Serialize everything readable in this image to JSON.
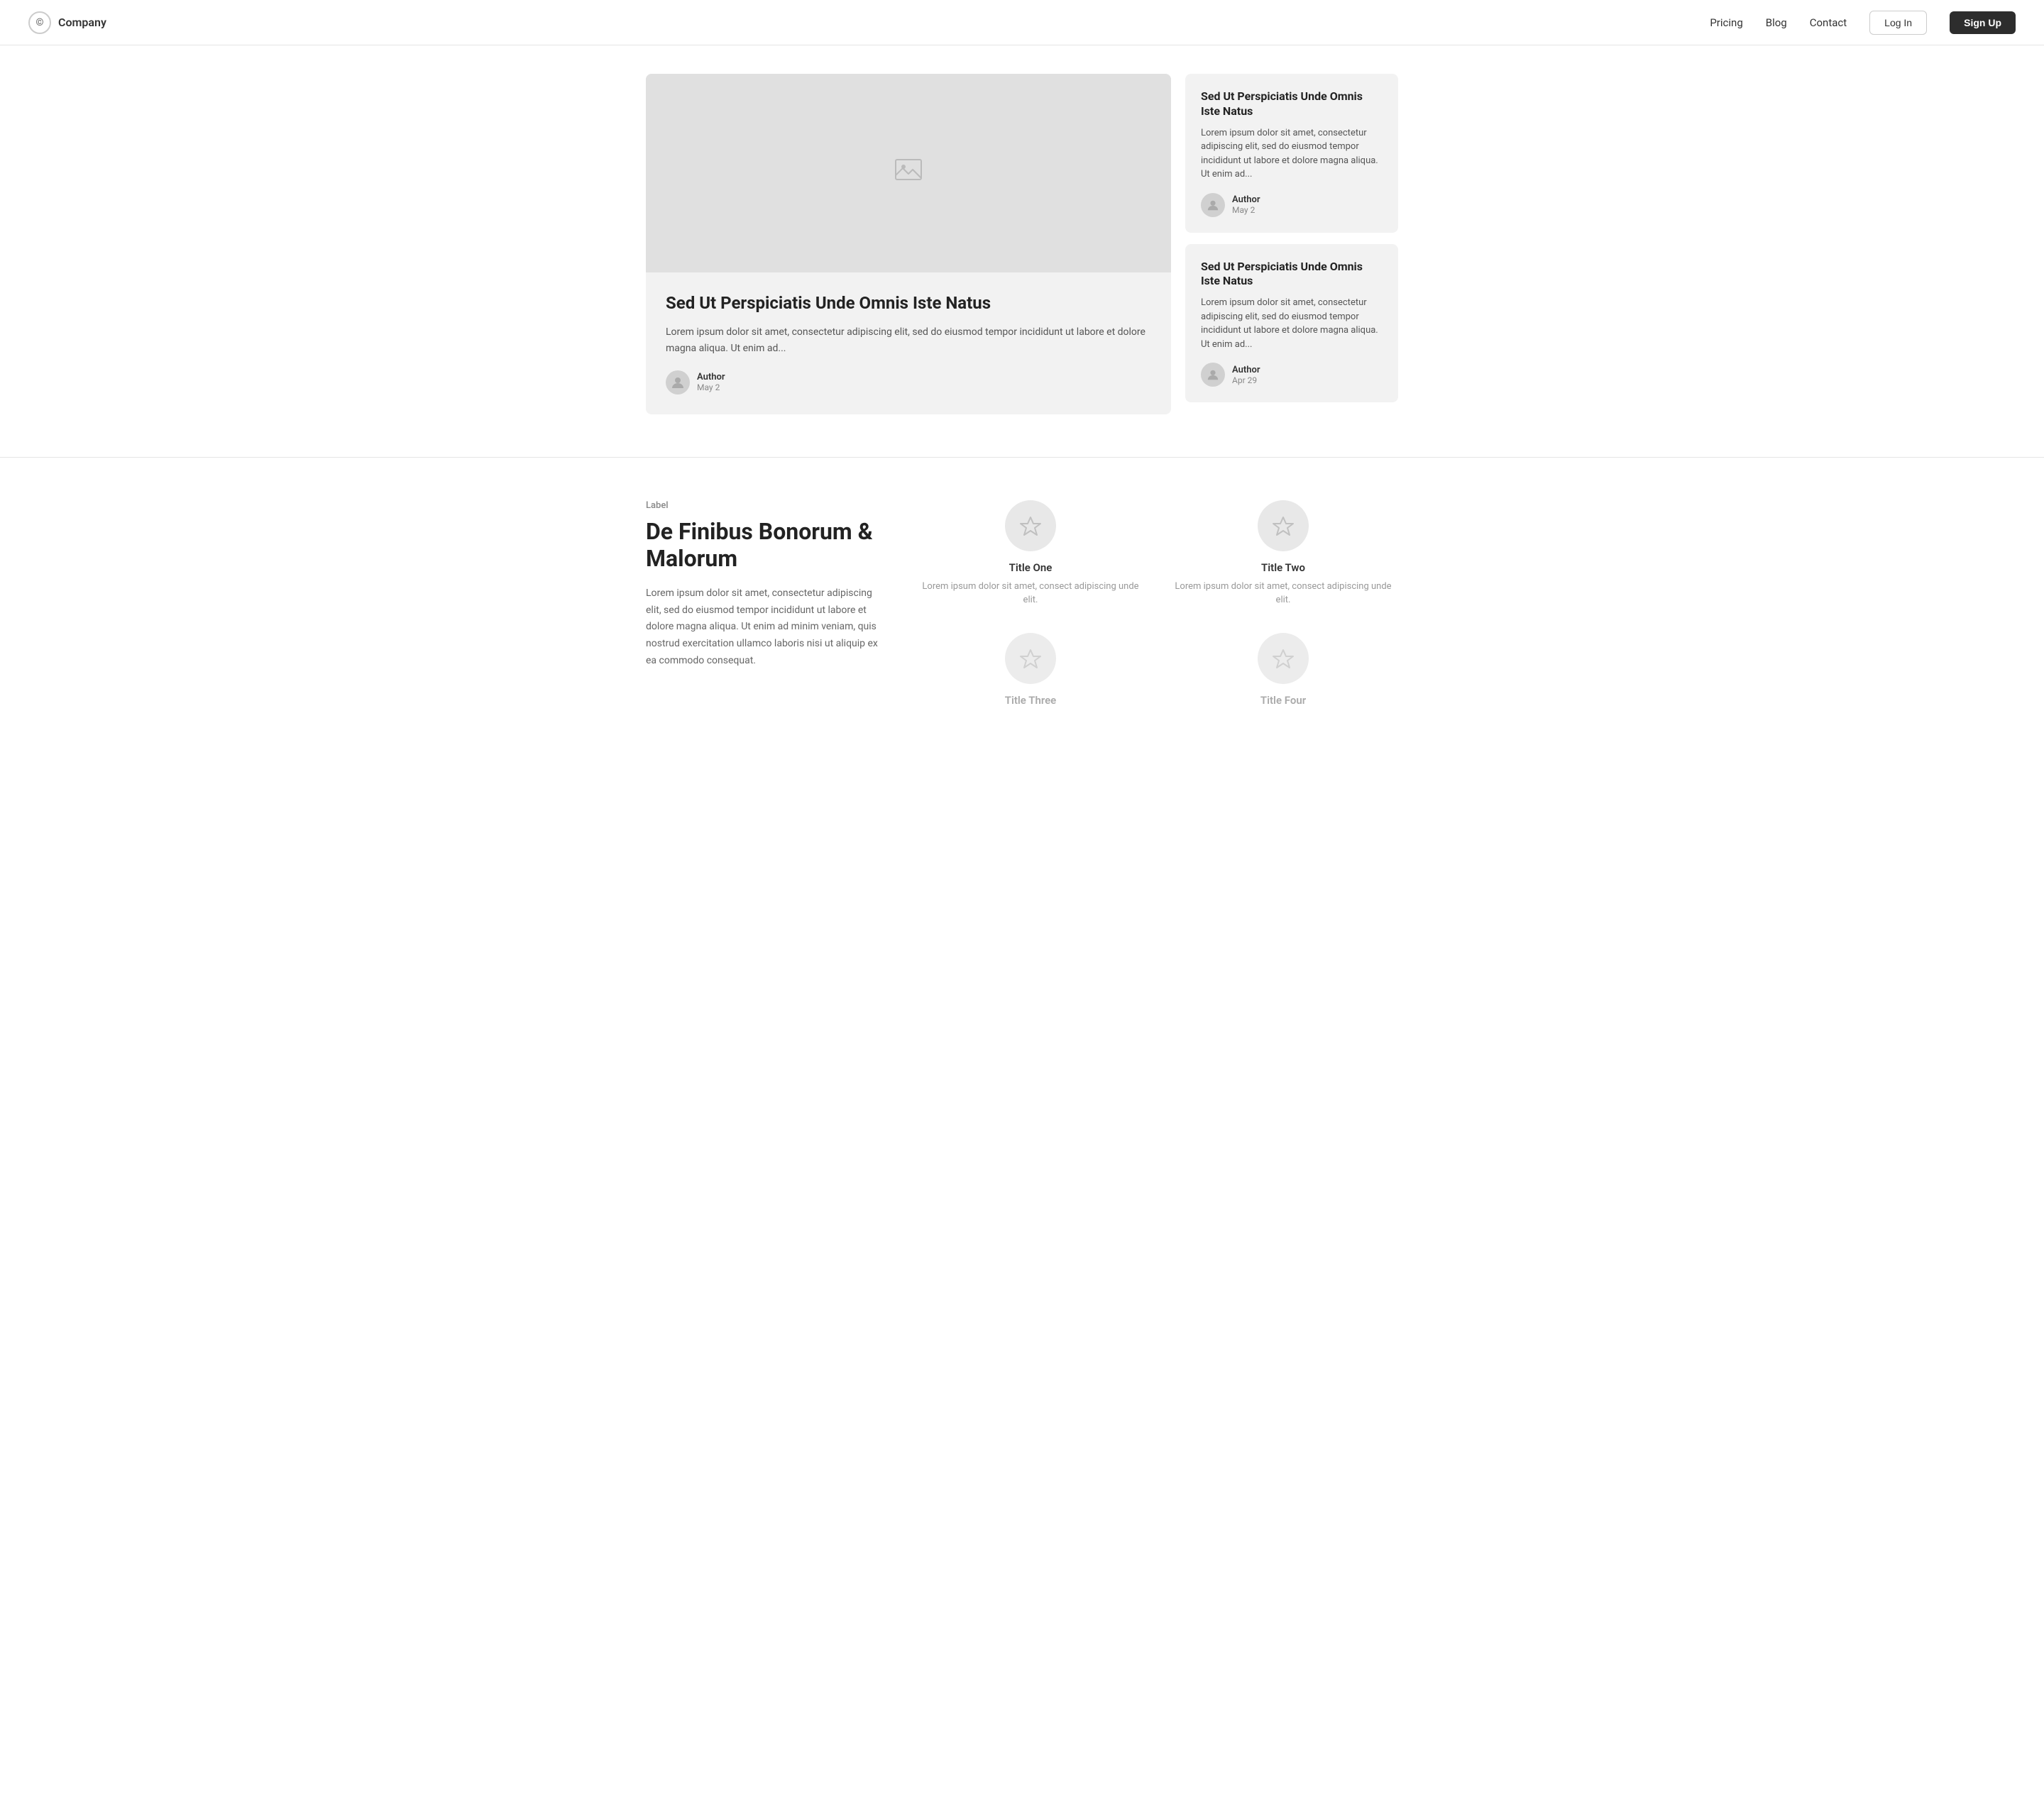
{
  "navbar": {
    "brand_icon": "©",
    "brand_name": "Company",
    "nav_links": [
      "Pricing",
      "Blog",
      "Contact"
    ],
    "login_label": "Log In",
    "signup_label": "Sign Up"
  },
  "featured_post": {
    "title": "Sed Ut Perspiciatis Unde Omnis Iste Natus",
    "excerpt": "Lorem ipsum dolor sit amet, consectetur adipiscing elit, sed do eiusmod tempor incididunt ut labore et dolore magna aliqua. Ut enim ad...",
    "author_name": "Author",
    "author_date": "May 2"
  },
  "side_posts": [
    {
      "title": "Sed Ut Perspiciatis Unde Omnis Iste Natus",
      "excerpt": "Lorem ipsum dolor sit amet, consectetur adipiscing elit, sed do eiusmod tempor incididunt ut labore et dolore magna aliqua. Ut enim ad...",
      "author_name": "Author",
      "author_date": "May 2"
    },
    {
      "title": "Sed Ut Perspiciatis Unde Omnis Iste Natus",
      "excerpt": "Lorem ipsum dolor sit amet, consectetur adipiscing elit, sed do eiusmod tempor incididunt ut labore et dolore magna aliqua. Ut enim ad...",
      "author_name": "Author",
      "author_date": "Apr 29"
    }
  ],
  "features_section": {
    "label": "Label",
    "heading": "De Finibus Bonorum & Malorum",
    "description": "Lorem ipsum dolor sit amet, consectetur adipiscing elit, sed do eiusmod tempor incididunt ut labore et dolore magna aliqua. Ut enim ad minim veniam, quis nostrud exercitation ullamco laboris nisi ut aliquip ex ea commodo consequat.",
    "items": [
      {
        "title": "Title One",
        "description": "Lorem ipsum dolor sit amet, consect adipiscing unde elit.",
        "muted": false
      },
      {
        "title": "Title Two",
        "description": "Lorem ipsum dolor sit amet, consect adipiscing unde elit.",
        "muted": false
      },
      {
        "title": "Title Three",
        "description": "",
        "muted": true
      },
      {
        "title": "Title Four",
        "description": "",
        "muted": true
      }
    ]
  }
}
